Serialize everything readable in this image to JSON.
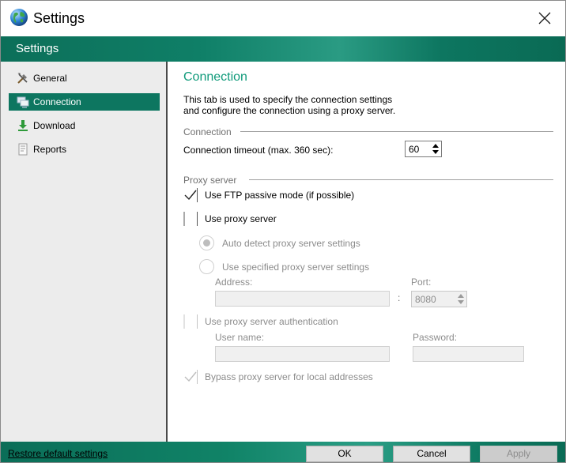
{
  "window": {
    "title": "Settings",
    "header": "Settings"
  },
  "sidebar": {
    "items": [
      {
        "label": "General",
        "icon": "tools-icon"
      },
      {
        "label": "Connection",
        "icon": "network-icon",
        "active": true
      },
      {
        "label": "Download",
        "icon": "download-arrow-icon"
      },
      {
        "label": "Reports",
        "icon": "report-document-icon"
      }
    ]
  },
  "content": {
    "title": "Connection",
    "description": "This tab is used to specify the connection settings\nand configure the connection using a proxy server.",
    "connection_group": {
      "label": "Connection",
      "timeout_label": "Connection timeout (max. 360 sec):",
      "timeout_value": "60"
    },
    "proxy_group": {
      "label": "Proxy server",
      "ftp_passive": {
        "label": "Use FTP passive mode (if possible)",
        "checked": true
      },
      "use_proxy": {
        "label": "Use proxy server",
        "checked": false
      },
      "auto_detect": {
        "label": "Auto detect proxy server settings",
        "selected": true
      },
      "use_specified": {
        "label": "Use specified proxy server settings",
        "selected": false
      },
      "address_label": "Address:",
      "address_value": "",
      "colon": ":",
      "port_label": "Port:",
      "port_value": "8080",
      "auth": {
        "label": "Use proxy server authentication",
        "checked": false
      },
      "username_label": "User name:",
      "password_label": "Password:",
      "bypass": {
        "label": "Bypass proxy server for local addresses",
        "checked": true
      }
    }
  },
  "footer": {
    "restore_label": "Restore default settings",
    "ok_label": "OK",
    "cancel_label": "Cancel",
    "apply_label": "Apply"
  },
  "colors": {
    "accent_green": "#0d7660",
    "title_green": "#0f9a7a",
    "sidebar_bg": "#ececec"
  }
}
